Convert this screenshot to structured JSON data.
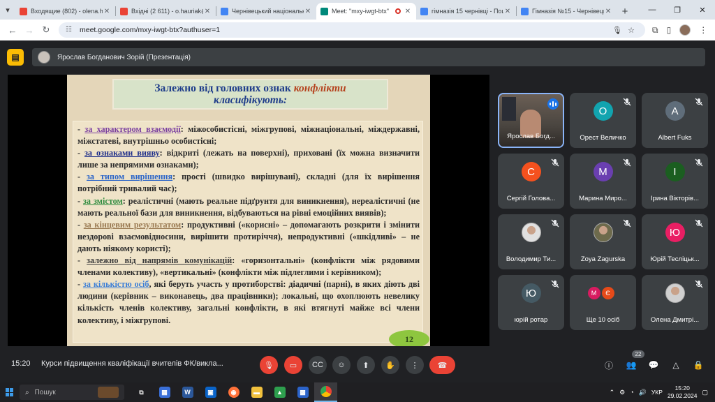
{
  "browser": {
    "tabs": [
      {
        "label": "Входящие (802) - olena.ha",
        "icon": "gmail-icon",
        "color": "#ea4335",
        "active": false
      },
      {
        "label": "Вхідні (2 611) - o.hauriak@",
        "icon": "gmail-icon",
        "color": "#ea4335",
        "active": false
      },
      {
        "label": "Чернівецький національн",
        "icon": "site-icon",
        "color": "#4285f4",
        "active": false
      },
      {
        "label": "Meet: \"mxy-iwgt-btx\"",
        "icon": "meet-icon",
        "color": "#00897b",
        "active": true
      },
      {
        "label": "гімназія 15 чернівці - Пош",
        "icon": "google-icon",
        "color": "#4285f4",
        "active": false
      },
      {
        "label": "Гімназія №15 - Чернівецьк",
        "icon": "site-icon",
        "color": "#4285f4",
        "active": false
      }
    ],
    "url": "meet.google.com/mxy-iwgt-btx?authuser=1"
  },
  "meet": {
    "presenter_label": "Ярослав Богданович Зорій (Презентація)",
    "slide": {
      "title_part1": "Залежно від головних ознак ",
      "title_conflict": "конфлікти",
      "title_line2": "класифікують:",
      "items": [
        {
          "prefix": "- ",
          "keyword": "за характером взаємодії",
          "kw_color": "purple",
          "text": ": міжособистісні, міжгрупові, міжнаціональні, міждержавні, міжстатеві, внутрішньо особистісні;"
        },
        {
          "prefix": "- ",
          "keyword": "за ознаками вияву",
          "kw_color": "navy",
          "text": ": відкриті (лежать на поверхні), приховані (їх можна визначити лише за непрямими ознаками);"
        },
        {
          "prefix": "- ",
          "keyword": "за типом вирішення",
          "kw_color": "blue",
          "text": ": прості (швидко вирішувані), складні (для їх вирішення потрібний тривалий час);"
        },
        {
          "prefix": "- ",
          "keyword": "за змістом",
          "kw_color": "green",
          "text": ": реалістичні (мають реальне підґрунтя для виникнення), нереалістичні (не мають реальної бази для виникнення, відбуваються на рівні емоційних виявів);"
        },
        {
          "prefix": "- ",
          "keyword": "за кінцевим результатом",
          "kw_color": "brown",
          "text": ": продуктивні («корисні» – допомагають розкрити і змінити нездорові взаємовідносини, вирішити протиріччя), непродуктивні («шкідливі» – не дають ніякому користі);"
        },
        {
          "prefix": "- ",
          "keyword": "залежно від напрямів комунікацій",
          "kw_color": "dark",
          "text": ": «горизонтальні» (конфлікти між рядовими членами колективу), «вертикальні» (конфлікти між підлеглими і керівником);"
        },
        {
          "prefix": "- ",
          "keyword": "за кількістю осіб",
          "kw_color": "lblue",
          "text": ", які беруть участь у протиборстві: діадичні (парні), в яких діють дві людини (керівник – виконавець, два працівники); локальні, що охоплюють невелику кількість членів колективу, загальні конфлікти, в які втягнуті майже всі члени колективу, і міжгрупові."
        }
      ],
      "page_number": "12"
    },
    "participants": [
      {
        "name": "Ярослав Богд...",
        "initial": "",
        "avatar_color": "",
        "type": "camera",
        "speaking": true
      },
      {
        "name": "Орест Величко",
        "initial": "О",
        "avatar_color": "#12a4af",
        "type": "letter",
        "speaking": false
      },
      {
        "name": "Albert Fuks",
        "initial": "A",
        "avatar_color": "#5f6d7a",
        "type": "letter",
        "speaking": false
      },
      {
        "name": "Сергій Голова...",
        "initial": "С",
        "avatar_color": "#f4511e",
        "type": "letter",
        "speaking": false
      },
      {
        "name": "Марина Миро...",
        "initial": "М",
        "avatar_color": "#6a3fb0",
        "type": "letter",
        "speaking": false
      },
      {
        "name": "Ірина Вікторів...",
        "initial": "І",
        "avatar_color": "#1b5e20",
        "type": "letter",
        "speaking": false
      },
      {
        "name": "Володимир Ти...",
        "initial": "",
        "avatar_color": "#e0e0e0",
        "type": "photo",
        "speaking": false
      },
      {
        "name": "Zoya Zagurska",
        "initial": "",
        "avatar_color": "#6d6a4c",
        "type": "photo",
        "speaking": false
      },
      {
        "name": "Юрій Тесліцьк...",
        "initial": "Ю",
        "avatar_color": "#e91e63",
        "type": "letter",
        "speaking": false
      },
      {
        "name": "юрій ротар",
        "initial": "Ю",
        "avatar_color": "#455a64",
        "type": "letter",
        "speaking": false
      },
      {
        "name": "Ще 10 осіб",
        "initial": "",
        "avatar_color": "",
        "type": "group",
        "speaking": false,
        "group_avatars": [
          {
            "initial": "М",
            "color": "#d81b60"
          },
          {
            "initial": "Є",
            "color": "#e64a19"
          }
        ]
      },
      {
        "name": "Олена Дмитрі...",
        "initial": "",
        "avatar_color": "#d0d0d0",
        "type": "photo",
        "speaking": false
      }
    ],
    "bottom": {
      "time": "15:20",
      "meeting_title": "Курси підвищення кваліфікації вчителів ФК/викла...",
      "participant_count": "22"
    }
  },
  "taskbar": {
    "search_placeholder": "Пошук",
    "lang": "УКР",
    "time": "15:20",
    "date": "29.02.2024"
  }
}
